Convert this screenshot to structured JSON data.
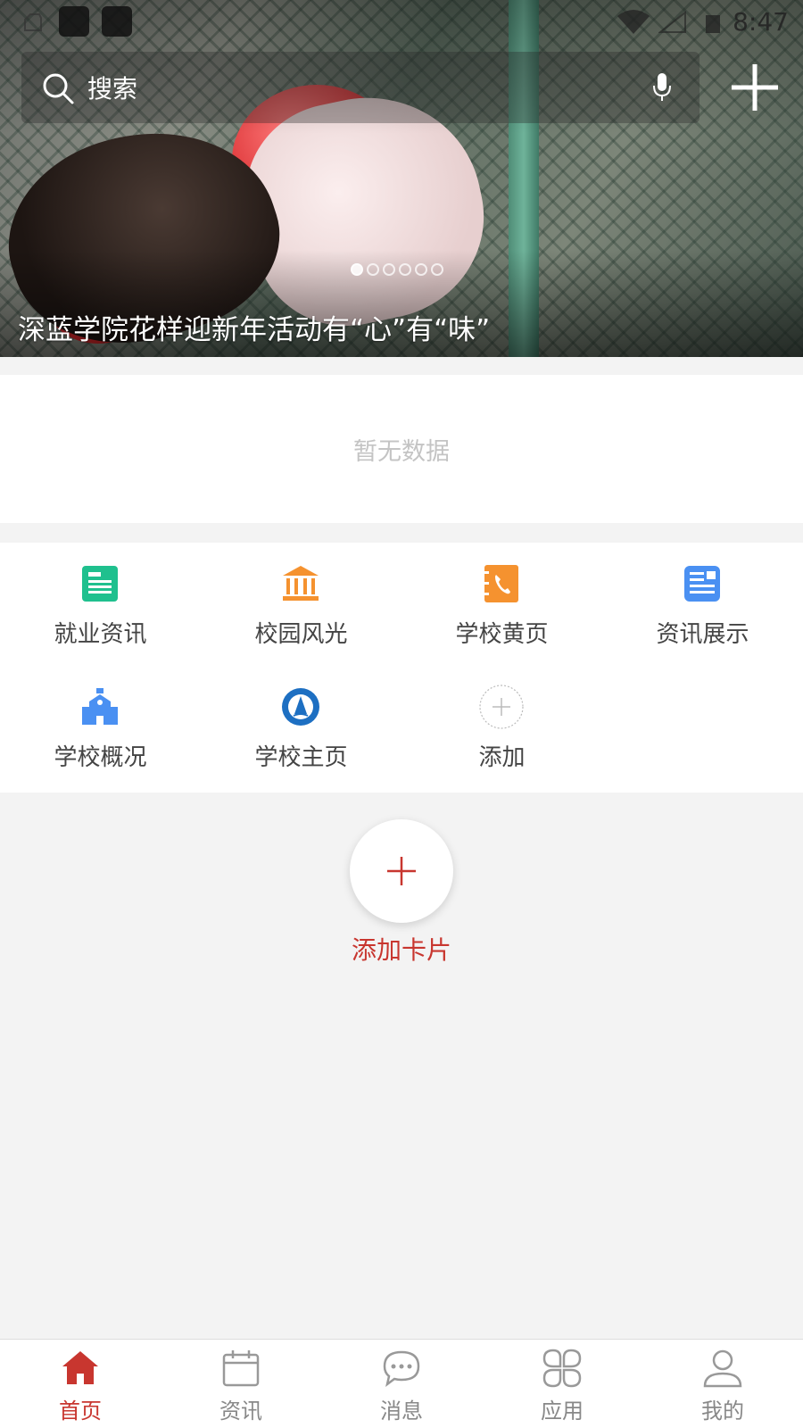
{
  "status_bar": {
    "time": "8:47"
  },
  "search": {
    "placeholder": "搜索"
  },
  "banner": {
    "title": "深蓝学院花样迎新年活动有“心”有“味”",
    "slide_count": 6,
    "active_slide": 0
  },
  "news_card": {
    "empty_text": "暂无数据"
  },
  "apps": [
    {
      "label": "就业资讯",
      "icon": "newspaper-icon",
      "color": "#1fc08e"
    },
    {
      "label": "校园风光",
      "icon": "institution-icon",
      "color": "#f5922f"
    },
    {
      "label": "学校黄页",
      "icon": "phone-book-icon",
      "color": "#f5922f"
    },
    {
      "label": "资讯展示",
      "icon": "news-list-icon",
      "color": "#4a90f2"
    },
    {
      "label": "学校概况",
      "icon": "school-building-icon",
      "color": "#4a90f2"
    },
    {
      "label": "学校主页",
      "icon": "school-logo-icon",
      "color": "#1d6fc2"
    },
    {
      "label": "添加",
      "icon": "add-circle-icon",
      "color": "#cccccc"
    }
  ],
  "add_card": {
    "label": "添加卡片"
  },
  "bottom_nav": [
    {
      "label": "首页",
      "icon": "home-icon",
      "active": true
    },
    {
      "label": "资讯",
      "icon": "calendar-icon",
      "active": false
    },
    {
      "label": "消息",
      "icon": "chat-bubble-icon",
      "active": false
    },
    {
      "label": "应用",
      "icon": "apps-grid-icon",
      "active": false
    },
    {
      "label": "我的",
      "icon": "person-icon",
      "active": false
    }
  ],
  "colors": {
    "accent": "#c8362f",
    "background": "#f3f3f3"
  }
}
